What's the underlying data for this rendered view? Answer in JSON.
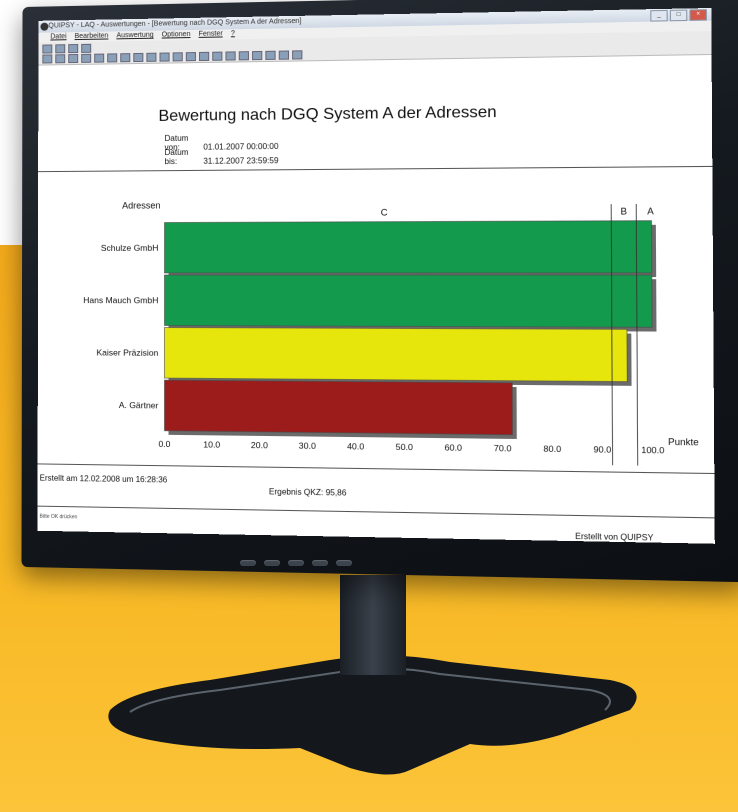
{
  "window": {
    "title": "QUIPSY - LAQ - Auswertungen - [Bewertung nach DGQ System A der Adressen]",
    "controls": [
      "_",
      "□",
      "×"
    ]
  },
  "menu": [
    "Datei",
    "Bearbeiten",
    "Auswertung",
    "Optionen",
    "Fenster",
    "?"
  ],
  "report": {
    "title": "Bewertung nach DGQ System A der Adressen",
    "date_from_label": "Datum von:",
    "date_from": "01.01.2007 00:00:00",
    "date_to_label": "Datum bis:",
    "date_to": "31.12.2007 23:59:59",
    "created_on": "Erstellt am 12.02.2008 um 16:28:36",
    "result": "Ergebnis QKZ: 95,86",
    "created_by": "Erstellt von QUIPSY",
    "status": "Bitte OK drücken"
  },
  "chart_data": {
    "type": "bar",
    "orientation": "horizontal",
    "categories": [
      "Schulze GmbH",
      "Hans Mauch GmbH",
      "Kaiser Präzision",
      "A. Gärtner"
    ],
    "values": [
      100.0,
      100.0,
      95.0,
      72.0
    ],
    "colors": [
      "#149a4c",
      "#149a4c",
      "#e6e60c",
      "#9c1c1c"
    ],
    "ylabel": "Adressen",
    "xlabel": "Punkte",
    "xlim": [
      0,
      100
    ],
    "xticks": [
      "0.0",
      "10.0",
      "20.0",
      "30.0",
      "40.0",
      "50.0",
      "60.0",
      "70.0",
      "80.0",
      "90.0",
      "100.0"
    ],
    "class_labels": [
      "C",
      "B",
      "A"
    ],
    "class_thresholds": [
      92,
      97
    ]
  }
}
